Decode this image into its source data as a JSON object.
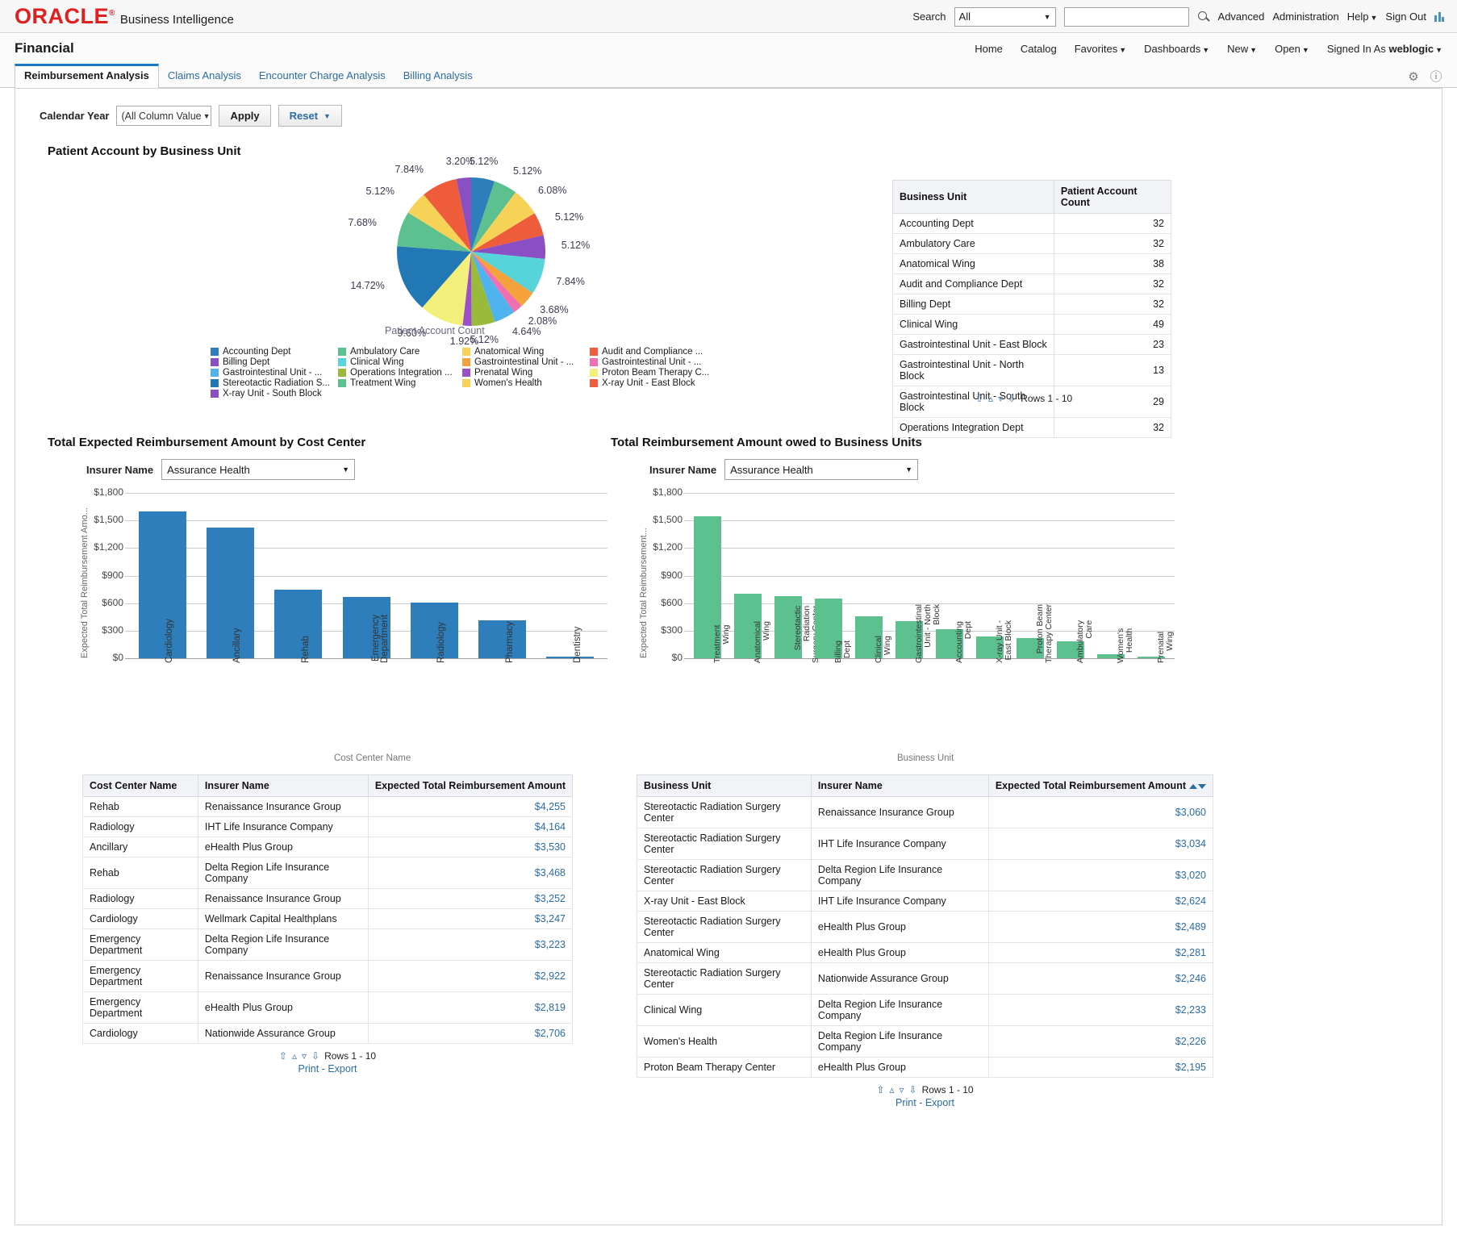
{
  "header": {
    "logo_text": "ORACLE",
    "logo_reg": "®",
    "logo_sub": "Business Intelligence",
    "search_label": "Search",
    "search_scope": "All",
    "search_placeholder": "",
    "search_value": "",
    "advanced": "Advanced",
    "administration": "Administration",
    "help": "Help",
    "sign_out": "Sign Out",
    "search_icon": "search-icon",
    "report_icon": "bars-icon"
  },
  "dashboard": {
    "title": "Financial",
    "nav": [
      "Home",
      "Catalog",
      "Favorites",
      "Dashboards",
      "New",
      "Open"
    ],
    "signed_in_label": "Signed In As",
    "user": "weblogic",
    "gear_icon": "gear-icon",
    "help_icon": "question-icon"
  },
  "tabs": [
    {
      "label": "Reimbursement Analysis",
      "active": true
    },
    {
      "label": "Claims Analysis",
      "active": false
    },
    {
      "label": "Encounter Charge Analysis",
      "active": false
    },
    {
      "label": "Billing Analysis",
      "active": false
    }
  ],
  "prompt": {
    "label": "Calendar Year",
    "value": "(All Column Value",
    "apply": "Apply",
    "reset": "Reset"
  },
  "pie_section": {
    "title": "Patient Account by Business Unit"
  },
  "bu_table": {
    "columns": [
      "Business Unit",
      "Patient Account Count"
    ],
    "rows": [
      [
        "Accounting Dept",
        "32"
      ],
      [
        "Ambulatory Care",
        "32"
      ],
      [
        "Anatomical Wing",
        "38"
      ],
      [
        "Audit and Compliance Dept",
        "32"
      ],
      [
        "Billing Dept",
        "32"
      ],
      [
        "Clinical Wing",
        "49"
      ],
      [
        "Gastrointestinal Unit - East Block",
        "23"
      ],
      [
        "Gastrointestinal Unit - North Block",
        "13"
      ],
      [
        "Gastrointestinal Unit - South Block",
        "29"
      ],
      [
        "Operations Integration Dept",
        "32"
      ]
    ],
    "rows_label": "Rows 1 - 10"
  },
  "left_panel": {
    "title": "Total Expected Reimbursement Amount by Cost Center",
    "insurer_label": "Insurer Name",
    "insurer_value": "Assurance Health"
  },
  "right_panel": {
    "title": "Total Reimbursement Amount owed to Business Units",
    "insurer_label": "Insurer Name",
    "insurer_value": "Assurance Health"
  },
  "left_table": {
    "columns": [
      "Cost Center Name",
      "Insurer Name",
      "Expected Total Reimbursement Amount"
    ],
    "rows": [
      [
        "Rehab",
        "Renaissance Insurance Group",
        "$4,255"
      ],
      [
        "Radiology",
        "IHT Life Insurance Company",
        "$4,164"
      ],
      [
        "Ancillary",
        "eHealth Plus Group",
        "$3,530"
      ],
      [
        "Rehab",
        "Delta Region Life Insurance Company",
        "$3,468"
      ],
      [
        "Radiology",
        "Renaissance Insurance Group",
        "$3,252"
      ],
      [
        "Cardiology",
        "Wellmark Capital Healthplans",
        "$3,247"
      ],
      [
        "Emergency Department",
        "Delta Region Life Insurance Company",
        "$3,223"
      ],
      [
        "Emergency Department",
        "Renaissance Insurance Group",
        "$2,922"
      ],
      [
        "Emergency Department",
        "eHealth Plus Group",
        "$2,819"
      ],
      [
        "Cardiology",
        "Nationwide Assurance Group",
        "$2,706"
      ]
    ],
    "rows_label": "Rows 1 - 10",
    "print": "Print",
    "export": "Export"
  },
  "right_table": {
    "columns": [
      "Business Unit",
      "Insurer Name",
      "Expected Total Reimbursement Amount"
    ],
    "rows": [
      [
        "Stereotactic Radiation Surgery Center",
        "Renaissance Insurance Group",
        "$3,060"
      ],
      [
        "Stereotactic Radiation Surgery Center",
        "IHT Life Insurance Company",
        "$3,034"
      ],
      [
        "Stereotactic Radiation Surgery Center",
        "Delta Region Life Insurance Company",
        "$3,020"
      ],
      [
        "X-ray Unit - East Block",
        "IHT Life Insurance Company",
        "$2,624"
      ],
      [
        "Stereotactic Radiation Surgery Center",
        "eHealth Plus Group",
        "$2,489"
      ],
      [
        "Anatomical Wing",
        "eHealth Plus Group",
        "$2,281"
      ],
      [
        "Stereotactic Radiation Surgery Center",
        "Nationwide Assurance Group",
        "$2,246"
      ],
      [
        "Clinical Wing",
        "Delta Region Life Insurance Company",
        "$2,233"
      ],
      [
        "Women's Health",
        "Delta Region Life Insurance Company",
        "$2,226"
      ],
      [
        "Proton Beam Therapy Center",
        "eHealth Plus Group",
        "$2,195"
      ]
    ],
    "rows_label": "Rows 1 - 10",
    "print": "Print",
    "export": "Export"
  },
  "chart_data": [
    {
      "type": "pie",
      "title": "Patient Account by Business Unit",
      "axis_label": "Patient Account Count",
      "legend_position": "bottom",
      "slices": [
        {
          "label": "Accounting Dept",
          "pct": 5.12,
          "color": "#2e7ebb"
        },
        {
          "label": "Ambulatory Care",
          "pct": 5.12,
          "color": "#5cc08f"
        },
        {
          "label": "Anatomical Wing",
          "pct": 6.08,
          "color": "#f6d256"
        },
        {
          "label": "Audit and Compliance ...",
          "pct": 5.12,
          "color": "#ef5c3c"
        },
        {
          "label": "Billing Dept",
          "pct": 5.12,
          "color": "#8b4fc4"
        },
        {
          "label": "Clinical Wing",
          "pct": 7.84,
          "color": "#57d4da"
        },
        {
          "label": "Gastrointestinal Unit - ...",
          "pct": 3.68,
          "color": "#f6a23c"
        },
        {
          "label": "Gastrointestinal Unit - ...",
          "pct": 2.08,
          "color": "#ef6fb0"
        },
        {
          "label": "Gastrointestinal Unit - ...",
          "pct": 4.64,
          "color": "#4fb3ee"
        },
        {
          "label": "Operations Integration ...",
          "pct": 5.12,
          "color": "#9aba3a"
        },
        {
          "label": "Prenatal Wing",
          "pct": 1.92,
          "color": "#9b4fc9"
        },
        {
          "label": "Proton Beam Therapy C...",
          "pct": 9.6,
          "color": "#f2f07a"
        },
        {
          "label": "Stereotactic Radiation S...",
          "pct": 14.72,
          "color": "#2277b5"
        },
        {
          "label": "Treatment Wing",
          "pct": 7.68,
          "color": "#5cc08f"
        },
        {
          "label": "Women's Health",
          "pct": 5.12,
          "color": "#f6d256"
        },
        {
          "label": "X-ray Unit - East Block",
          "pct": 7.84,
          "color": "#ef5c3c"
        },
        {
          "label": "X-ray Unit - South Block",
          "pct": 3.2,
          "color": "#8b4fc4"
        }
      ]
    },
    {
      "type": "bar",
      "title": "Total Expected Reimbursement Amount by Cost Center",
      "xlabel": "Cost Center Name",
      "ylabel": "Expected Total Reimbursement Amo...",
      "ylim": [
        0,
        1800
      ],
      "yticks": [
        "$0",
        "$300",
        "$600",
        "$900",
        "$1,200",
        "$1,500",
        "$1,800"
      ],
      "grid": true,
      "bar_color": "#2e7ebb",
      "categories": [
        "Cardiology",
        "Ancillary",
        "Rehab",
        "Emergency\nDepartment",
        "Radiology",
        "Pharmacy",
        "Dentistry"
      ],
      "values": [
        1600,
        1420,
        745,
        665,
        610,
        410,
        12
      ]
    },
    {
      "type": "bar",
      "title": "Total Reimbursement Amount owed to Business Units",
      "xlabel": "Business Unit",
      "ylabel": "Expected Total Reimbursement...",
      "ylim": [
        0,
        1800
      ],
      "yticks": [
        "$0",
        "$300",
        "$600",
        "$900",
        "$1,200",
        "$1,500",
        "$1,800"
      ],
      "grid": true,
      "bar_color": "#5cc08f",
      "categories": [
        "Treatment\nWing",
        "Anatomical\nWing",
        "Stereotactic\nRadiation\nSurgery Center",
        "Billing\nDept",
        "Clinical\nWing",
        "Gastrointestinal\nUnit - North\nBlock",
        "Accounting\nDept",
        "X-ray Unit -\nEast Block",
        "Proton Beam\nTherapy Center",
        "Ambulatory\nCare",
        "Women's\nHealth",
        "Prenatal\nWing"
      ],
      "values": [
        1545,
        700,
        680,
        650,
        455,
        405,
        315,
        235,
        218,
        185,
        40,
        12
      ]
    }
  ]
}
